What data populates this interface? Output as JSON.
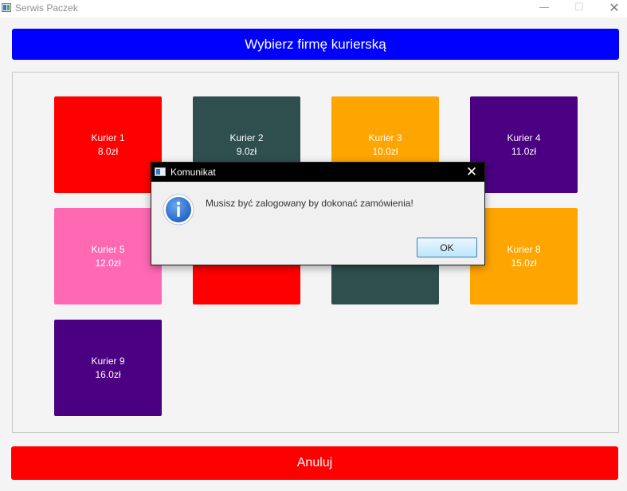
{
  "window": {
    "title": "Serwis Paczek",
    "controls": {
      "minimize": "—",
      "maximize": "☐",
      "close": "✕"
    }
  },
  "header": {
    "label": "Wybierz firmę kurierską",
    "color": "#0000ff"
  },
  "couriers": [
    {
      "name": "Kurier 1",
      "price": "8.0zł",
      "color": "#ff0000"
    },
    {
      "name": "Kurier 2",
      "price": "9.0zł",
      "color": "#2f4f4f"
    },
    {
      "name": "Kurier 3",
      "price": "10.0zł",
      "color": "#ffa500"
    },
    {
      "name": "Kurier 4",
      "price": "11.0zł",
      "color": "#4b0082"
    },
    {
      "name": "Kurier 5",
      "price": "12.0zł",
      "color": "#ff69b4"
    },
    {
      "name": "",
      "price": "",
      "color": "#ff0000"
    },
    {
      "name": "",
      "price": "",
      "color": "#2f4f4f"
    },
    {
      "name": "Kurier 8",
      "price": "15.0zł",
      "color": "#ffa500"
    },
    {
      "name": "Kurier 9",
      "price": "16.0zł",
      "color": "#4b0082"
    }
  ],
  "footer": {
    "cancel_label": "Anuluj",
    "color": "#ff0000"
  },
  "dialog": {
    "title": "Komunikat",
    "icon": "info-icon",
    "message": "Musisz być zalogowany by dokonać zamówienia!",
    "ok_label": "OK",
    "close_glyph": "✕"
  }
}
